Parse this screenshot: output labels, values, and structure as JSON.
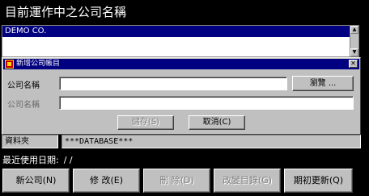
{
  "main": {
    "title": "目前運作中之公司名稱",
    "company_list": [
      "DEMO CO."
    ],
    "scroll_up": "▲",
    "scroll_down": "▼"
  },
  "dialog": {
    "title": "新增公司帳目",
    "close": "✕",
    "field1_label": "公司名稱",
    "field1_value": "",
    "browse_button": "瀏覽 ...",
    "field2_label": "公司名稱",
    "field2_value": "",
    "save_button": "儲存(S)",
    "cancel_button": "取消(C)"
  },
  "database": {
    "label": "資料夾",
    "path": "***DATABASE***"
  },
  "last_used": {
    "label": "最近使用日期:",
    "value": "/ /"
  },
  "buttons": {
    "new_company": "新公司(N)",
    "edit": "修 改(E)",
    "delete": "刪 除(D)",
    "change_dir": "改變目錄(G)",
    "period_update": "期初更新(Q)"
  }
}
